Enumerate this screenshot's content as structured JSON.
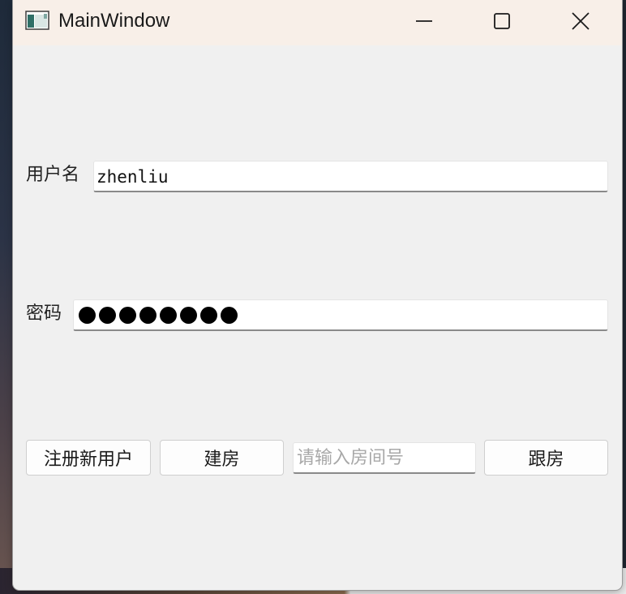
{
  "window": {
    "title": "MainWindow",
    "controls": {
      "minimize": "minimize-icon",
      "maximize": "maximize-icon",
      "close": "close-icon"
    }
  },
  "form": {
    "username_label": "用户名",
    "username_value": "zhenliu",
    "password_label": "密码",
    "password_mask_count": 8
  },
  "actions": {
    "register_label": "注册新用户",
    "create_room_label": "建房",
    "room_input_placeholder": "请输入房间号",
    "room_input_value": "",
    "join_room_label": "跟房"
  },
  "colors": {
    "titlebar": "#f8efe8",
    "window_bg": "#f0f0f0",
    "input_bg": "#ffffff",
    "placeholder": "#a8a8a8"
  }
}
